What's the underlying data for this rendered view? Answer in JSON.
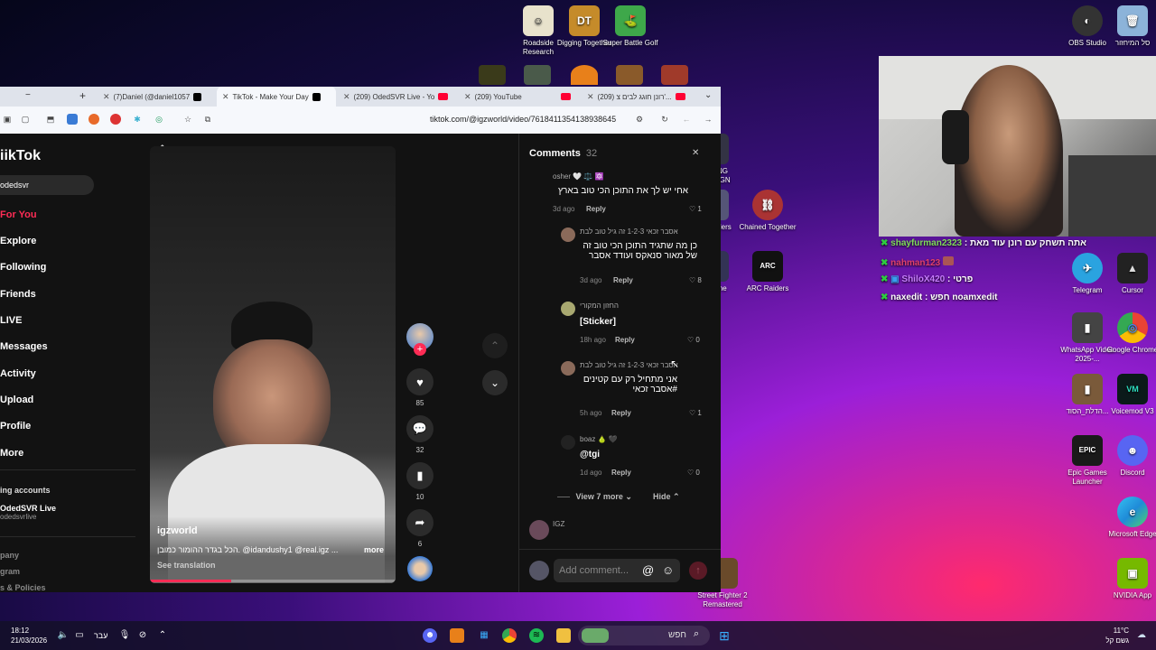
{
  "desktop": {
    "icons_top": [
      {
        "label": "Roadside Research",
        "color": "#e8e2cc",
        "glyph": "☺"
      },
      {
        "label": "Digging Together",
        "color": "#c58b2a",
        "glyph": "DT"
      },
      {
        "label": "Super Battle Golf",
        "color": "#3ea84a",
        "glyph": "⛳"
      }
    ],
    "icons_right_top": [
      {
        "label": "OBS Studio",
        "color": "#333333",
        "glyph": "◐"
      },
      {
        "label": "סל המיחזור",
        "color": "#8cb3d9",
        "glyph": "🗑"
      }
    ],
    "icons_mid": [
      {
        "label": "RING REIGN",
        "color": "#334"
      },
      {
        "label": "Raiders",
        "color": "#557"
      },
      {
        "label": "Chained Together",
        "color": "#a33",
        "glyph": "⛓"
      },
      {
        "label": "ARC Raiders",
        "color": "#111",
        "glyph": "ARC"
      },
      {
        "label": "Time",
        "color": "#335"
      }
    ],
    "icons_right": [
      {
        "label": "Telegram",
        "color": "#2aa3e0",
        "glyph": "✈"
      },
      {
        "label": "Cursor",
        "color": "#222222",
        "glyph": "▲"
      },
      {
        "label": "WhatsApp Video 2025-...",
        "color": "#444",
        "glyph": "▮"
      },
      {
        "label": "Google Chrome",
        "color": "#ffffff",
        "glyph": "◎"
      },
      {
        "label": "הדלת_הסוד...",
        "color": "#7a5a3a",
        "glyph": "▮"
      },
      {
        "label": "Voicemod V3",
        "color": "#0b1a1a",
        "glyph": "VM"
      },
      {
        "label": "Epic Games Launcher",
        "color": "#1a1a1a",
        "glyph": "EPIC"
      },
      {
        "label": "Discord",
        "color": "#5865f2",
        "glyph": "☻"
      },
      {
        "label": "Microsoft Edge",
        "color": "#1f8bd8",
        "glyph": "e"
      },
      {
        "label": "NVIDIA App",
        "color": "#76b900",
        "glyph": "▣"
      }
    ],
    "bottom_icon": {
      "label": "Street Fighter 2 Remastered",
      "color": "#6a4a2a"
    }
  },
  "browser": {
    "tabs": [
      {
        "label": "(7)Daniel (@daniel1057",
        "icon": "tiktok"
      },
      {
        "label": "TikTok - Make Your Day",
        "icon": "tiktok",
        "active": true
      },
      {
        "label": "(209) OdedSVR Live - Yo",
        "icon": "youtube"
      },
      {
        "label": "(209) YouTube",
        "icon": "youtube"
      },
      {
        "label": "(209) רונן חוגג לבים צ'...",
        "icon": "youtube"
      }
    ],
    "new_tab_label": "+",
    "minimize_label": "−",
    "url": "tiktok.com/@igzworld/video/7618411354138938645"
  },
  "tiktok": {
    "logo": "iikTok",
    "search_value": "odedsvr",
    "nav": [
      {
        "label": "For You",
        "active": true
      },
      {
        "label": "Explore"
      },
      {
        "label": "Following"
      },
      {
        "label": "Friends"
      },
      {
        "label": "LIVE"
      },
      {
        "label": "Messages"
      },
      {
        "label": "Activity"
      },
      {
        "label": "Upload"
      },
      {
        "label": "Profile"
      },
      {
        "label": "More"
      }
    ],
    "following_header": "ing accounts",
    "following_account": {
      "name": "OdedSVR Live",
      "handle": "odedsvrlive"
    },
    "footer": [
      "pany",
      "gram",
      "s & Policies"
    ],
    "video": {
      "author": "igzworld",
      "caption": "הכל בגדר ההומור כמובן. @idandushy1 @real.igz ...",
      "more_label": "more",
      "translate_label": "See translation",
      "progress": 0.33
    },
    "actions": {
      "likes": "85",
      "comments": "32",
      "saves": "10",
      "shares": "6"
    }
  },
  "comments_panel": {
    "title": "Comments",
    "count": "32",
    "close_label": "✕",
    "items": [
      {
        "user": "osher 🤍 ⚖️ 🔯",
        "text": "אחי יש לך את התוכן הכי טוב בארץ",
        "time": "3d ago",
        "reply": "Reply",
        "likes": "1"
      },
      {
        "user": "אסבר זכאי 1-2-3 זה גיל טוב לבת",
        "text": "כן מה שתגיד התוכן הכי טוב זה של מאור סנאקס ועודד אסבר",
        "time": "3d ago",
        "reply": "Reply",
        "likes": "8"
      },
      {
        "user": "החזון המקורי",
        "text": "[Sticker]",
        "time": "18h ago",
        "reply": "Reply",
        "likes": "0"
      },
      {
        "user": "אסבר זכאי 1-2-3 זה גיל טוב לבת",
        "text": "אני מתחיל רק עם קטינים #אסבר זכאי",
        "time": "5h ago",
        "reply": "Reply",
        "likes": "1"
      },
      {
        "user": "boaz 🍐 🖤",
        "text": "@tgi",
        "time": "1d ago",
        "reply": "Reply",
        "likes": "0"
      }
    ],
    "view_more": "View 7 more",
    "hide": "Hide",
    "next_user": "IGZ",
    "add_placeholder": "Add comment..."
  },
  "stream_chat": [
    {
      "user": "shayfurman2323",
      "text": ": אתה תשחק עם רונן עוד מאת",
      "color": "#7fdc5a"
    },
    {
      "user": "nahman123",
      "text": "",
      "color": "#e0406a"
    },
    {
      "user": "ShiloX420",
      "text": ": פרטי",
      "color": "#c77dff"
    },
    {
      "user": "naxedit",
      "text": ": חפש noamxedit",
      "color": "#ffffff"
    }
  ],
  "taskbar": {
    "time": "18:12",
    "date": "21/03/2026",
    "lang": "עבר",
    "search_label": "חפש",
    "weather_temp": "11°C",
    "weather_desc": "גשם קל"
  }
}
